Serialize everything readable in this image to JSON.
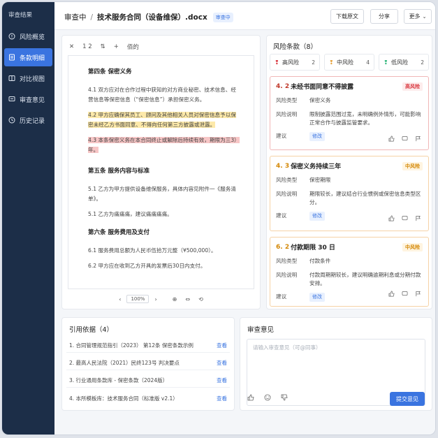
{
  "sidebar": {
    "brand": "审查结果",
    "items": [
      {
        "label": "风险概览",
        "icon": "alert-circle-icon"
      },
      {
        "label": "条款明细",
        "icon": "document-list-icon"
      },
      {
        "label": "对比视图",
        "icon": "compare-icon"
      },
      {
        "label": "审查意见",
        "icon": "comment-icon"
      },
      {
        "label": "历史记录",
        "icon": "history-icon"
      }
    ]
  },
  "header": {
    "status": "审查中",
    "separator": "/",
    "file_name": "技术服务合同（设备维保）.docx",
    "badge": "审查中",
    "download": "下载原文",
    "share": "分享",
    "more": "更多"
  },
  "doc": {
    "toolbar": {
      "page": "1 2",
      "title": "佰的"
    },
    "s4_title": "第四条  保密义务",
    "p41": "4.1 双方应对在合作过程中获知的对方商业秘密、技术信息、经营信息等保密信息（“保密信息”）承担保密义务。",
    "p42": "4.2 甲方应确保其员工、顾问及其他相关人员对保密信息予以保密未经乙方书面同意、不得向任何第三方披露或泄露。",
    "p43": "4.3 本条保密义务在本合同终止或解除后持续有效，期限为三3）年。",
    "s5_title": "第五条  服务内容与标准",
    "p51": "5.1 乙方为甲方提供设备维保服务，具体内容见附件一《服务清单》。",
    "p52": "5.1 乙方为痛痛痛，建议痛痛痛痛。",
    "s6_title": "第六条  服务费用及支付",
    "p61": "6.1 服务费用总额为人民币伍拾万元整（¥500,000）。",
    "p62": "6.2 甲方应在收到乙方开具的发票后30日内支付。",
    "zoom": "100%"
  },
  "risks": {
    "header": "风险条款（8）",
    "tabs": [
      {
        "label": "高风险",
        "count": "2",
        "color": "#d9363e"
      },
      {
        "label": "中风险",
        "count": "4",
        "color": "#e6a23c"
      },
      {
        "label": "低风险",
        "count": "2",
        "color": "#2fb67a"
      }
    ],
    "cards": [
      {
        "num": "4. 2",
        "title": "未经书面同意不得披露",
        "level": "高风险",
        "type_label": "风险类型",
        "type": "保密义务",
        "desc_label": "风险说明",
        "desc": "限制披露范围过宽，未明确例外情形，可能影响正常合作与披露监管要求。",
        "advice_label": "建议",
        "advice": "修改"
      },
      {
        "num": "4. 3",
        "title": "保密义务持续三年",
        "level": "中风险",
        "type_label": "风险类型",
        "type": "保密期限",
        "desc_label": "风险说明",
        "desc": "期限较长，建议结合行业惯例或保密信息类型区分。",
        "advice_label": "建议",
        "advice": "修改"
      },
      {
        "num": "6. 2",
        "title": "付款期限 30 日",
        "level": "中风险",
        "type_label": "风险类型",
        "type": "付款条件",
        "desc_label": "风险说明",
        "desc": "付款周期期较长，建议明确逾期利息或分期付款安排。",
        "advice_label": "建议",
        "advice": "修改"
      }
    ]
  },
  "refs": {
    "header": "引用依据（4）",
    "view": "查看",
    "items": [
      "1. 合同管理规范指引（2023）   第12条 保密条款示例",
      "2. 最高人民法院（2021）民终123号  判决要点",
      "3. 行业通用条款库 - 保密条款（2024版）",
      "4. 本所模板库：技术服务合同（标准版 v2.1）"
    ]
  },
  "opinion": {
    "header": "审查意见",
    "placeholder": "请输入审查意见（可@同事）",
    "submit": "提交意见"
  }
}
